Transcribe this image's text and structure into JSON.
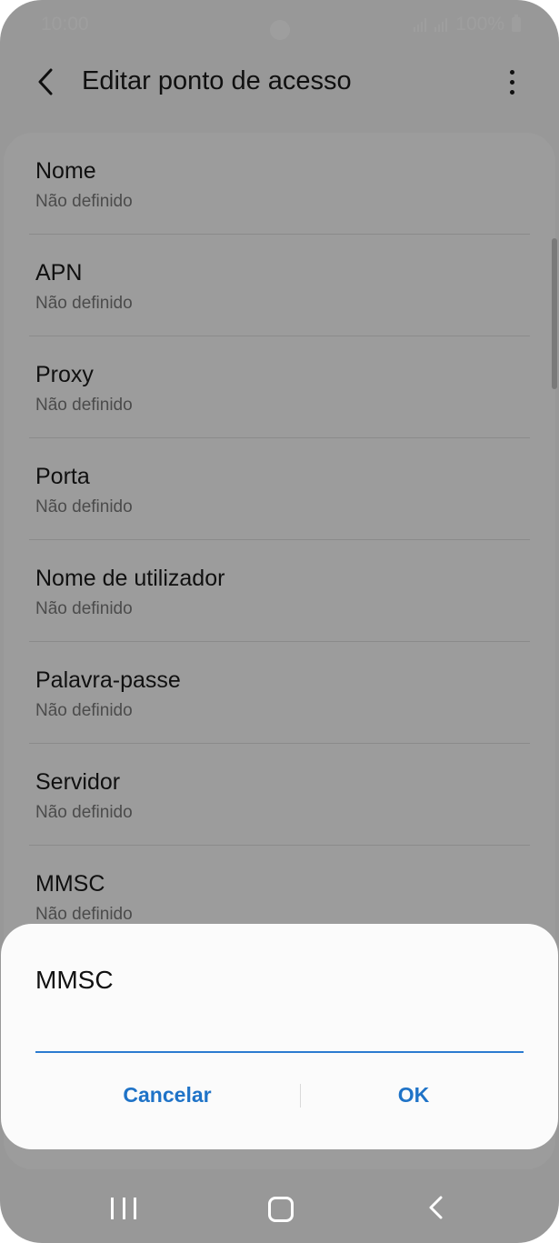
{
  "status_bar": {
    "time": "10:00",
    "battery": "100%"
  },
  "app_bar": {
    "title": "Editar ponto de acesso",
    "back_icon": "chevron-left-icon",
    "more_icon": "more-vertical-icon"
  },
  "list": {
    "items": [
      {
        "title": "Nome",
        "value": "Não definido"
      },
      {
        "title": "APN",
        "value": "Não definido"
      },
      {
        "title": "Proxy",
        "value": "Não definido"
      },
      {
        "title": "Porta",
        "value": "Não definido"
      },
      {
        "title": "Nome de utilizador",
        "value": "Não definido"
      },
      {
        "title": "Palavra-passe",
        "value": "Não definido"
      },
      {
        "title": "Servidor",
        "value": "Não definido"
      },
      {
        "title": "MMSC",
        "value": "Não definido"
      }
    ]
  },
  "dialog": {
    "title": "MMSC",
    "input_value": "",
    "cancel_label": "Cancelar",
    "ok_label": "OK"
  },
  "colors": {
    "accent": "#1f73c7",
    "input_underline": "#2b7bd0"
  },
  "nav_bar": {
    "recents_icon": "recents-icon",
    "home_icon": "home-icon",
    "back_icon": "back-icon"
  }
}
